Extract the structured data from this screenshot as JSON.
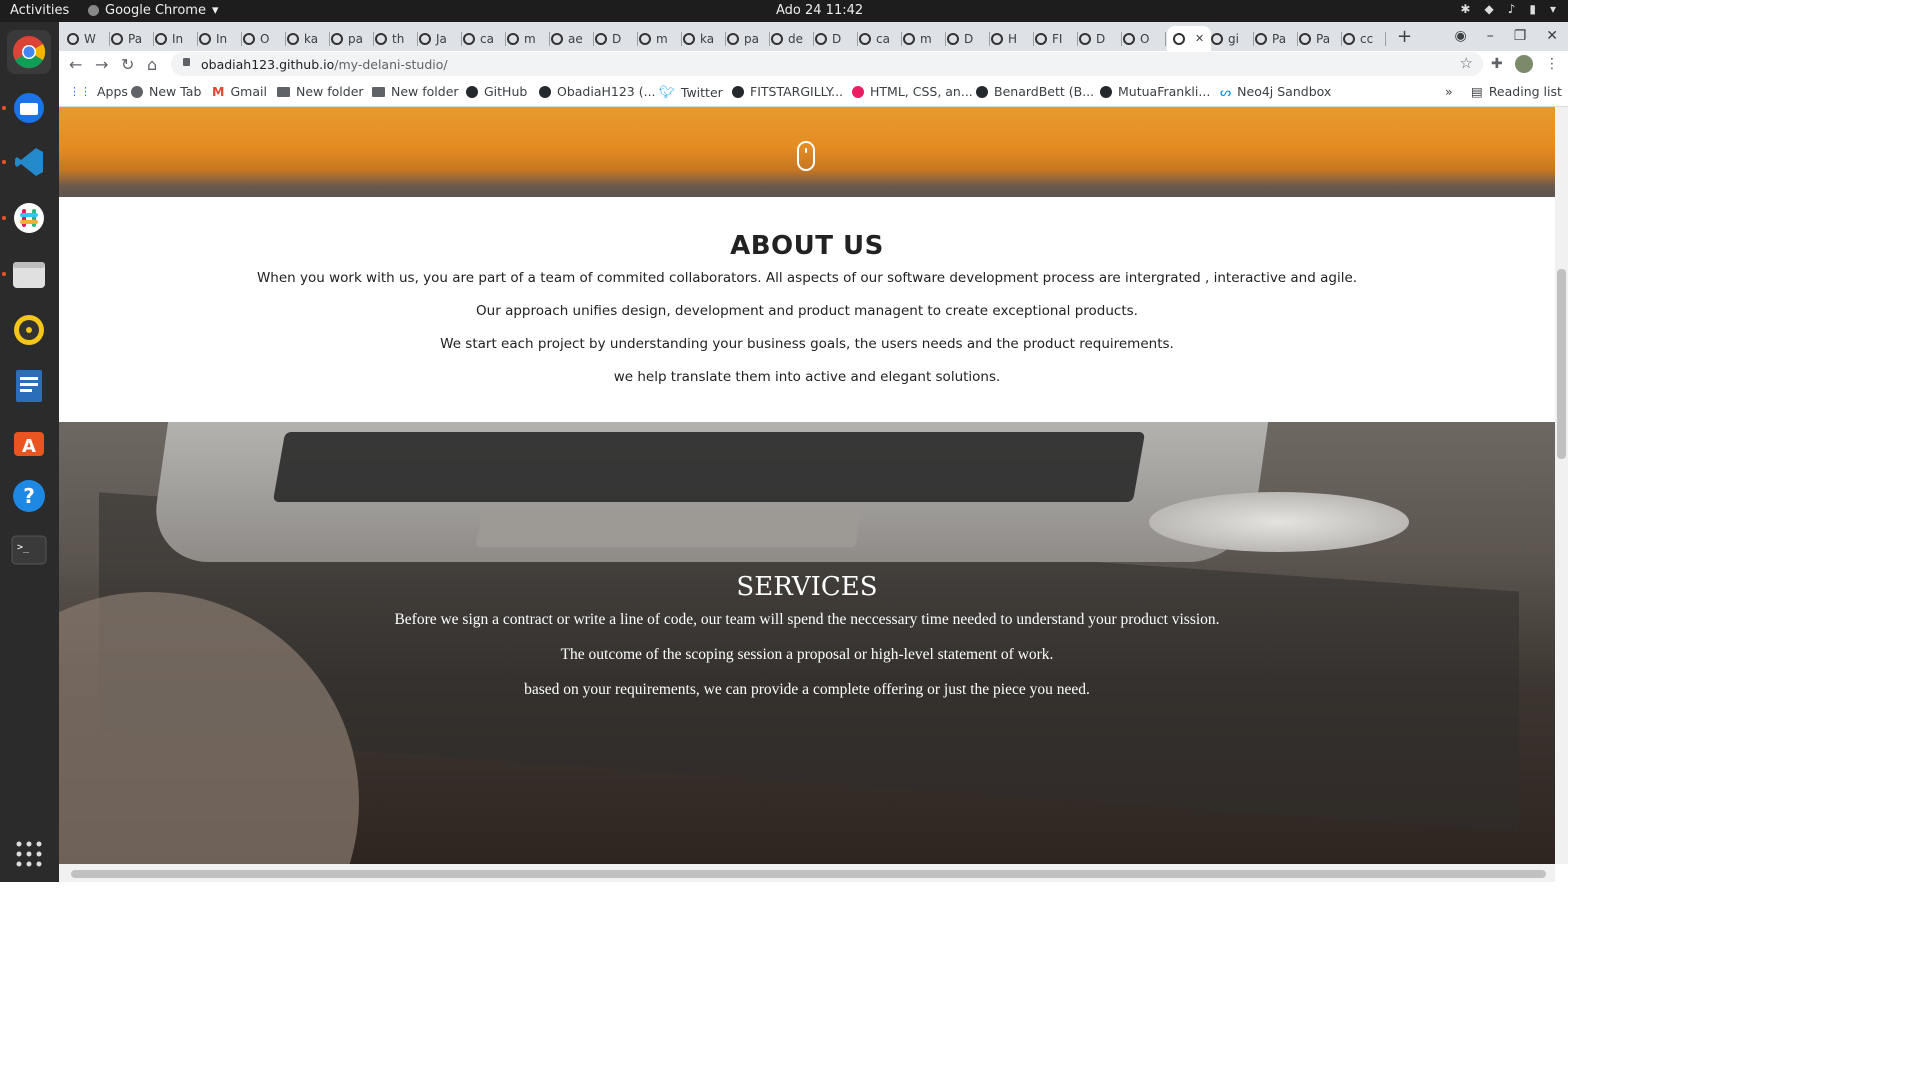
{
  "system": {
    "activities": "Activities",
    "app_name": "Google Chrome",
    "clock": "Ado 24  11:42"
  },
  "tabs": [
    {
      "label": "W"
    },
    {
      "label": "Pa"
    },
    {
      "label": "In"
    },
    {
      "label": "In"
    },
    {
      "label": "O"
    },
    {
      "label": "ka"
    },
    {
      "label": "pa"
    },
    {
      "label": "th"
    },
    {
      "label": "Ja"
    },
    {
      "label": "ca"
    },
    {
      "label": "m"
    },
    {
      "label": "ae"
    },
    {
      "label": "D"
    },
    {
      "label": "m"
    },
    {
      "label": "ka"
    },
    {
      "label": "pa"
    },
    {
      "label": "de"
    },
    {
      "label": "D"
    },
    {
      "label": "ca"
    },
    {
      "label": "m"
    },
    {
      "label": "D"
    },
    {
      "label": "H"
    },
    {
      "label": "FI"
    },
    {
      "label": "D"
    },
    {
      "label": "O"
    },
    {
      "label": "",
      "active": true
    },
    {
      "label": "gi"
    },
    {
      "label": "Pa"
    },
    {
      "label": "Pa"
    },
    {
      "label": "cc"
    }
  ],
  "toolbar": {
    "url_host": "obadiah123.github.io",
    "url_path": "/my-delani-studio/"
  },
  "bookmarks": {
    "apps": "Apps",
    "new_tab": "New Tab",
    "gmail": "Gmail",
    "folder1": "New folder",
    "folder2": "New folder",
    "github": "GitHub",
    "obadiah": "ObadiaH123 (...",
    "twitter": "Twitter",
    "fitstargilly": "FITSTARGILLY...",
    "html_css": "HTML, CSS, an...",
    "benard": "BenardBett (B...",
    "mutua": "MutuaFrankli...",
    "neo4j": "Neo4j Sandbox",
    "more": "»",
    "reading_list": "Reading list"
  },
  "about": {
    "title": "ABOUT US",
    "p1": "When you work with us, you are part of a team of commited collaborators. All aspects of our software development process are intergrated , interactive and agile.",
    "p2": "Our approach unifies design, development and product managent to create exceptional products.",
    "p3": "We start each project by understanding your business goals, the users needs and the product requirements.",
    "p4": "we help translate them into active and elegant solutions."
  },
  "services": {
    "title": "SERVICES",
    "p1": "Before we sign a contract or write a line of code, our team will spend the neccessary time needed to understand your product vission.",
    "p2": "The outcome of the scoping session a proposal or high-level statement of work.",
    "p3": "based on your requirements, we can provide a complete offering or just the piece you need."
  }
}
